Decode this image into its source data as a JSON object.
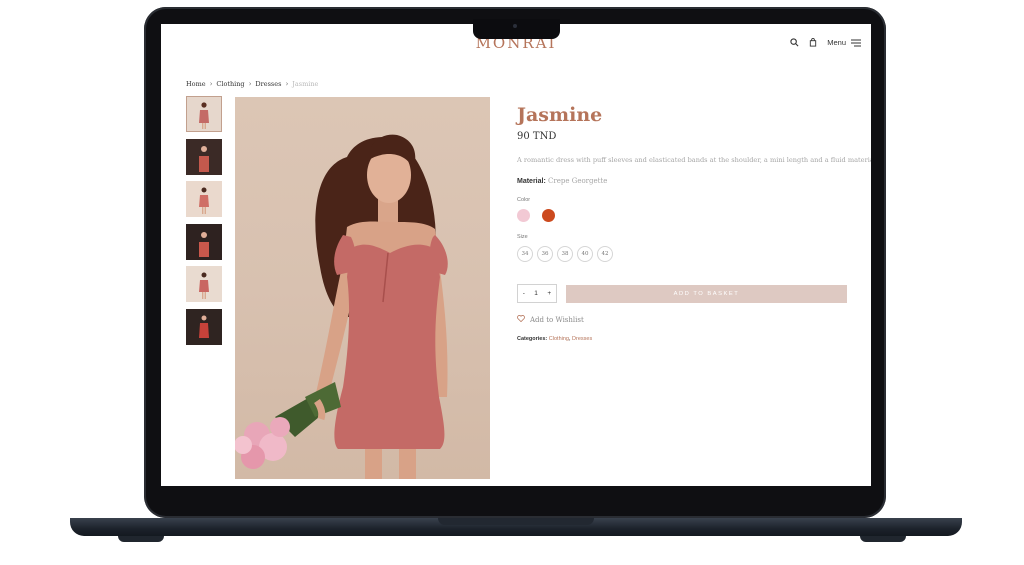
{
  "header": {
    "logo": "MONRAI",
    "menu_label": "Menu",
    "icons": [
      "search-icon",
      "bag-icon",
      "menu-icon"
    ]
  },
  "breadcrumb": [
    {
      "label": "Home"
    },
    {
      "label": "Clothing"
    },
    {
      "label": "Dresses"
    },
    {
      "label": "Jasmine"
    }
  ],
  "gallery": {
    "thumbnail_count": 6,
    "active_index": 0
  },
  "product": {
    "title": "Jasmine",
    "price": "90 TND",
    "description": "A romantic dress with puff sleeves and elasticated bands at the shoulder, a mini length and a fluid material.",
    "material_label": "Material:",
    "material_value": "Crepe Georgette",
    "color_label": "Color",
    "colors": [
      "#f2c9d4",
      "#cc4a1e"
    ],
    "size_label": "Size",
    "sizes": [
      "34",
      "36",
      "38",
      "40",
      "42"
    ],
    "quantity": {
      "minus": "-",
      "value": "1",
      "plus": "+"
    },
    "add_to_basket": "ADD TO BASKET",
    "wishlist": "Add to Wishlist",
    "categories_label": "Categories:",
    "categories": [
      "Clothing",
      "Dresses"
    ]
  },
  "colors": {
    "accent": "#b5745a",
    "button": "#dec9c2",
    "dress": "#c46a66"
  }
}
